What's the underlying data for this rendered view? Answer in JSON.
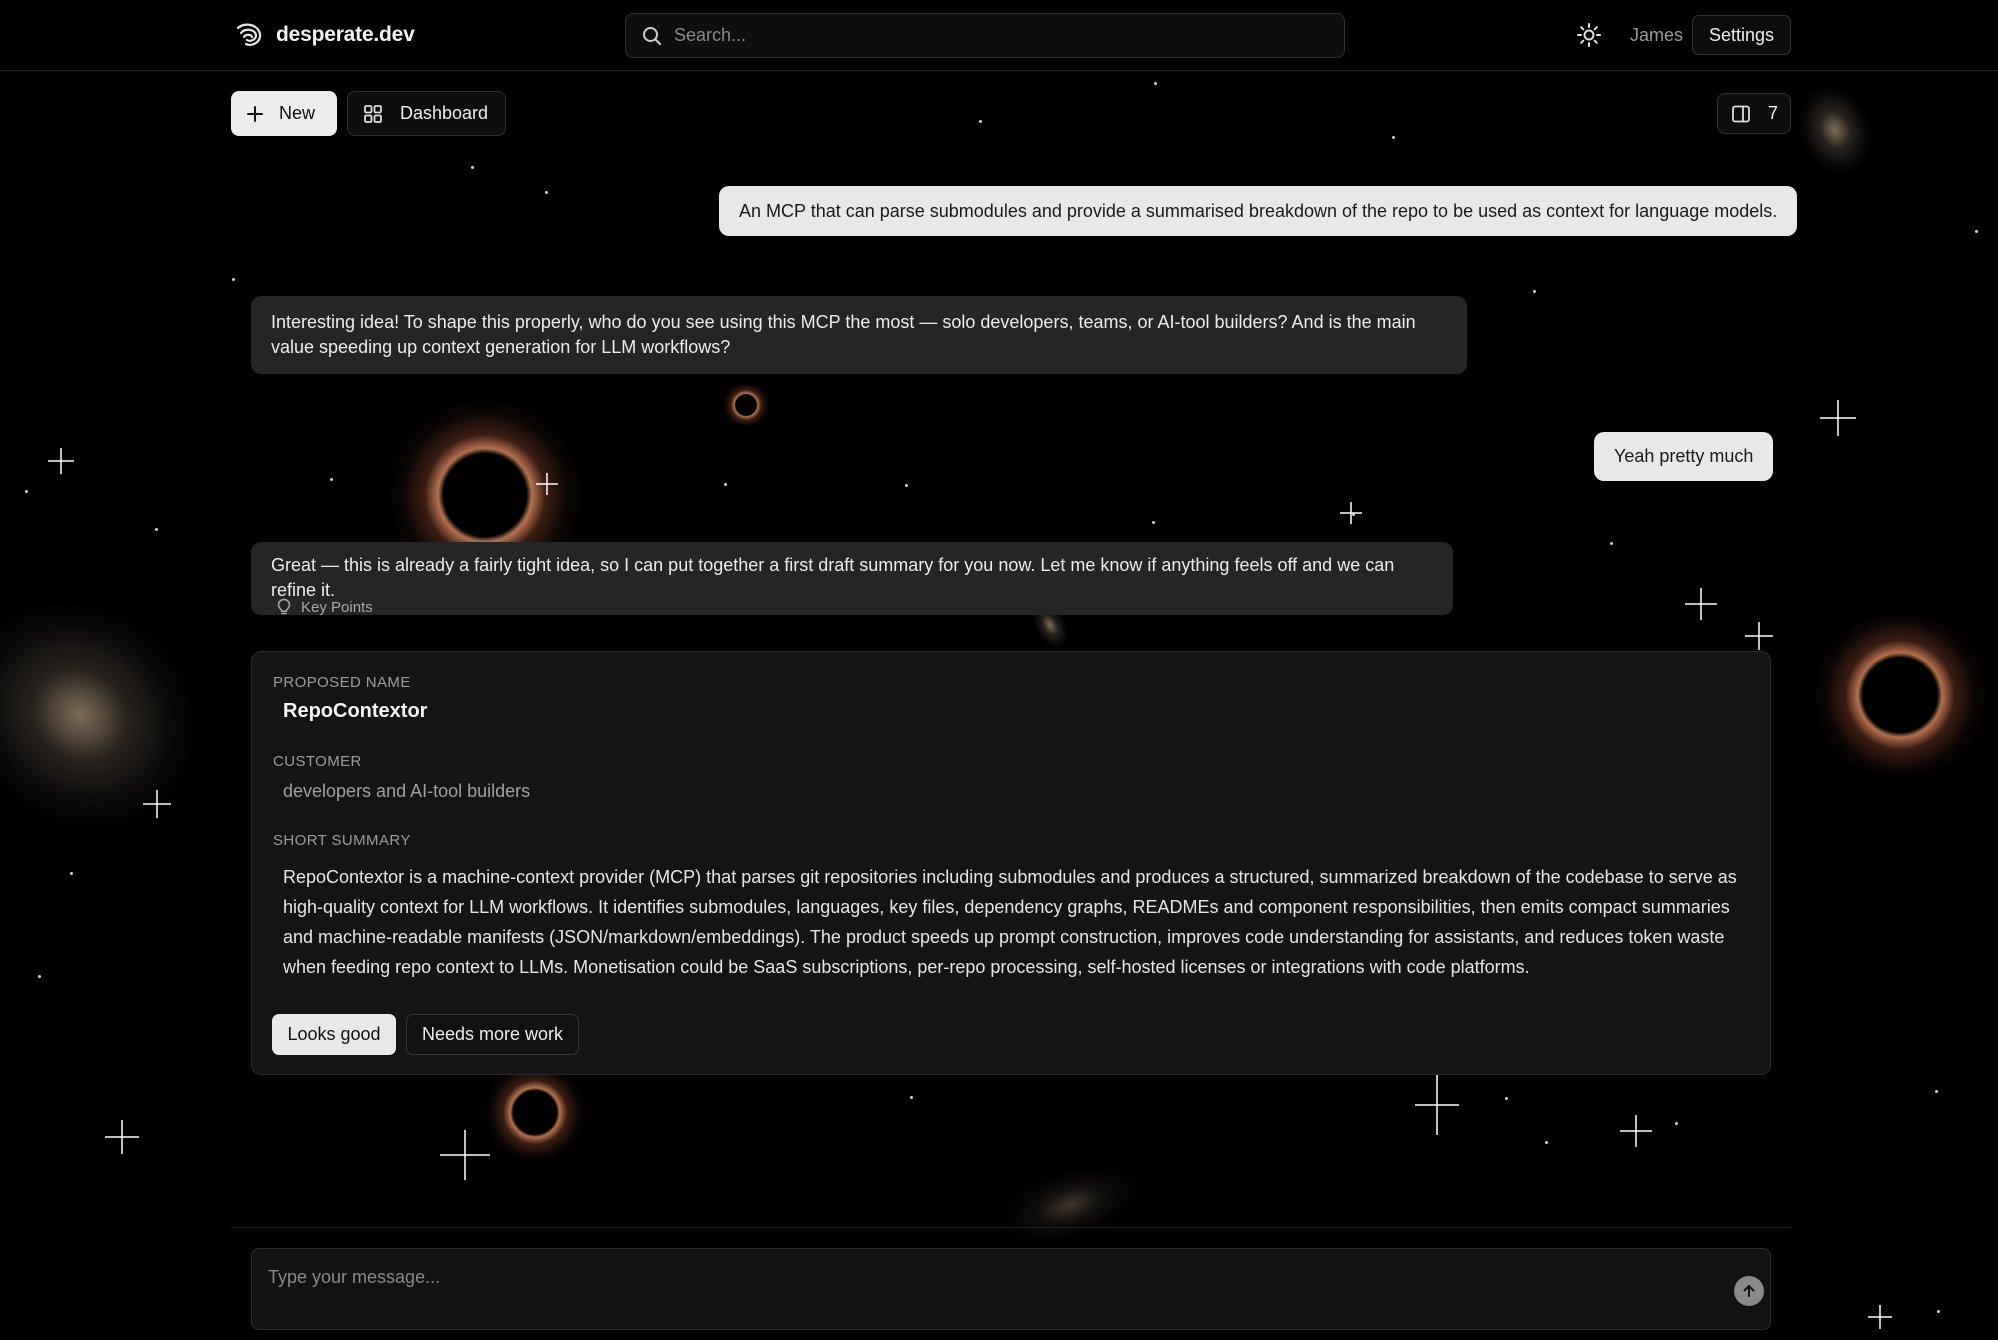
{
  "app": {
    "brand": "desperate.dev"
  },
  "header": {
    "search_placeholder": "Search...",
    "user_name": "James",
    "settings_label": "Settings"
  },
  "toolbar": {
    "new_label": "New",
    "dashboard_label": "Dashboard",
    "panel_count": "7"
  },
  "messages": [
    {
      "role": "user",
      "text": "An MCP that can parse submodules and provide a summarised breakdown of the repo to be used as context for language models."
    },
    {
      "role": "assistant",
      "text": "Interesting idea! To shape this properly, who do you see using this MCP the most — solo developers, teams, or AI-tool builders? And is the main value speeding up context generation for LLM workflows?"
    },
    {
      "role": "user",
      "text": "Yeah pretty much"
    },
    {
      "role": "assistant",
      "text": "Great — this is already a fairly tight idea, so I can put together a first draft summary for you now. Let me know if anything feels off and we can refine it."
    }
  ],
  "key_points_label": "Key Points",
  "proposal": {
    "name_label": "PROPOSED NAME",
    "name": "RepoContextor",
    "customer_label": "CUSTOMER",
    "customer": "developers and AI-tool builders",
    "summary_label": "SHORT SUMMARY",
    "summary": "RepoContextor is a machine-context provider (MCP) that parses git repositories including submodules and produces a structured, summarized breakdown of the codebase to serve as high-quality context for LLM workflows. It identifies submodules, languages, key files, dependency graphs, READMEs and component responsibilities, then emits compact summaries and machine-readable manifests (JSON/markdown/embeddings). The product speeds up prompt construction, improves code understanding for assistants, and reduces token waste when feeding repo context to LLMs. Monetisation could be SaaS subscriptions, per-repo processing, self-hosted licenses or integrations with code platforms.",
    "approve_label": "Looks good",
    "revise_label": "Needs more work"
  },
  "composer": {
    "placeholder": "Type your message..."
  },
  "colors": {
    "background": "#000000",
    "user_bubble": "#e8e8e8",
    "assistant_bubble": "#252525",
    "card": "#141414"
  }
}
